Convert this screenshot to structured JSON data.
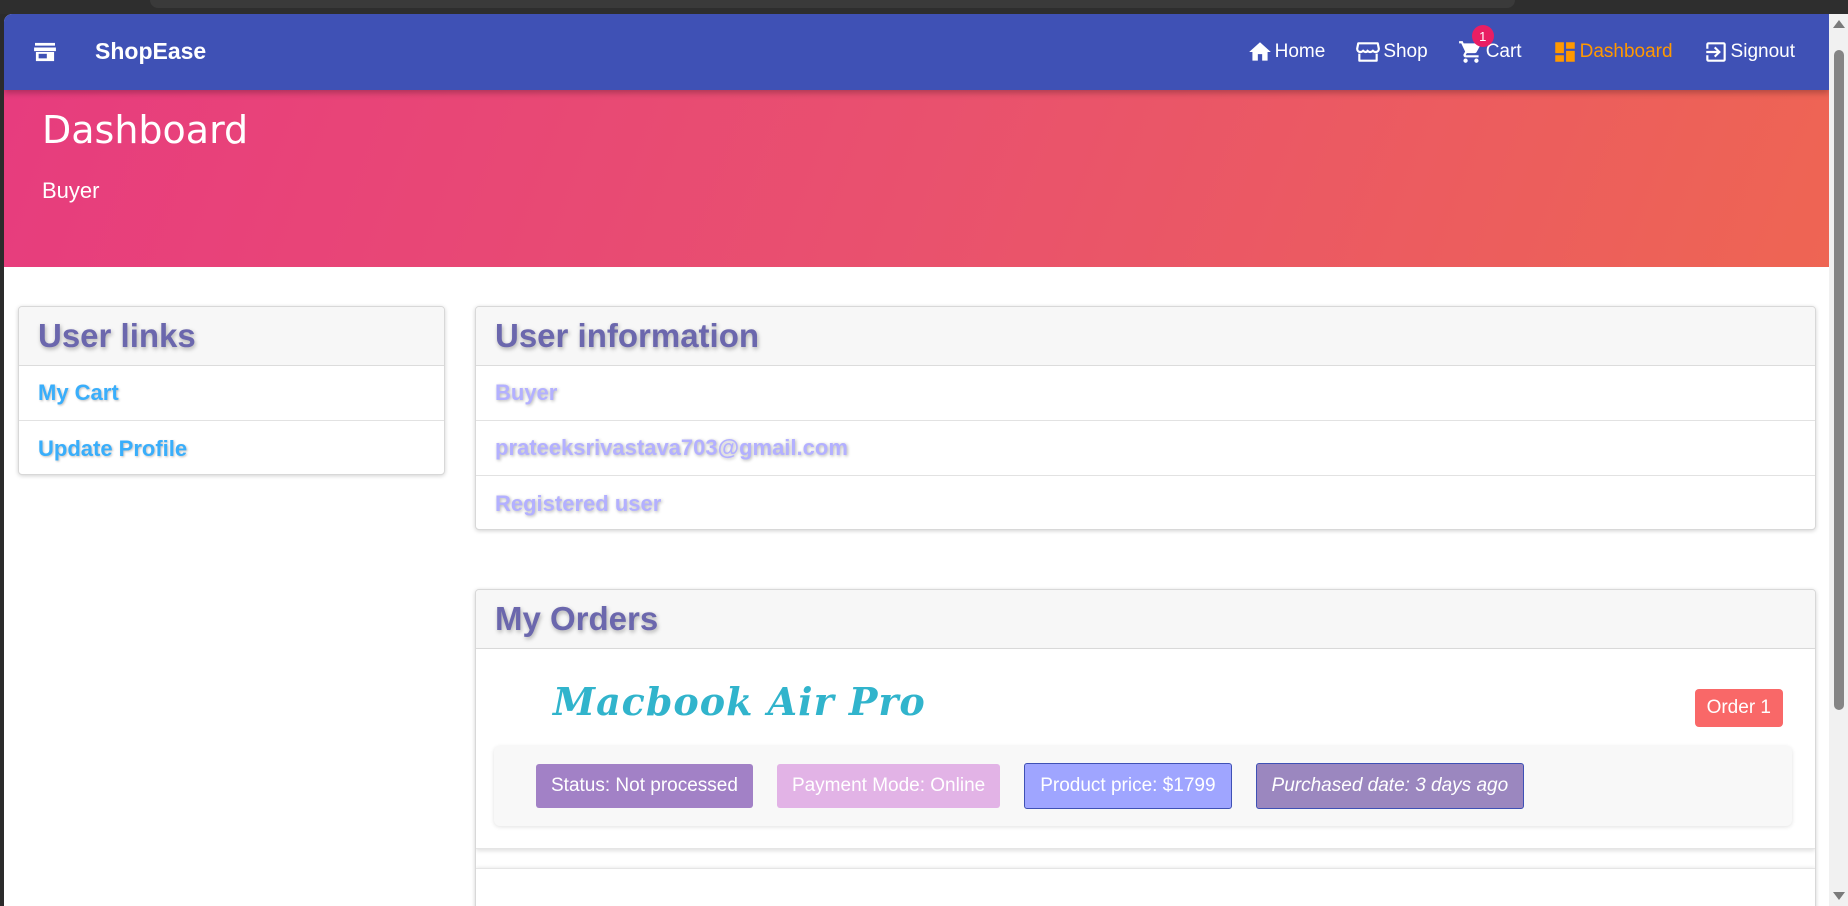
{
  "navbar": {
    "brand": "ShopEase",
    "links": [
      {
        "label": "Home",
        "icon": "home-icon"
      },
      {
        "label": "Shop",
        "icon": "storefront-icon"
      },
      {
        "label": "Cart",
        "icon": "cart-icon",
        "badge": "1"
      },
      {
        "label": "Dashboard",
        "icon": "dashboard-icon",
        "active": true
      },
      {
        "label": "Signout",
        "icon": "signout-icon"
      }
    ]
  },
  "header": {
    "title": "Dashboard",
    "subtitle": "Buyer"
  },
  "user_links": {
    "title": "User links",
    "items": [
      "My Cart",
      "Update Profile"
    ]
  },
  "user_info": {
    "title": "User information",
    "name": "Buyer",
    "email": "prateeksrivastava703@gmail.com",
    "role": "Registered user"
  },
  "orders": {
    "title": "My Orders",
    "items": [
      {
        "product": "Macbook Air Pro",
        "badge": "Order 1",
        "status": "Status: Not processed",
        "payment": "Payment Mode: Online",
        "price": "Product price: $1799",
        "date": "Purchased date: 3 days ago"
      }
    ]
  },
  "colors": {
    "navbar": "#3f51b5",
    "active_link": "#ff9800",
    "header_gradient_start": "#e73c7e",
    "header_gradient_end": "#ee6553",
    "card_title": "#6b67ad",
    "link": "#39aefb",
    "order_title": "#31b4cc",
    "order_badge": "#f96868"
  }
}
